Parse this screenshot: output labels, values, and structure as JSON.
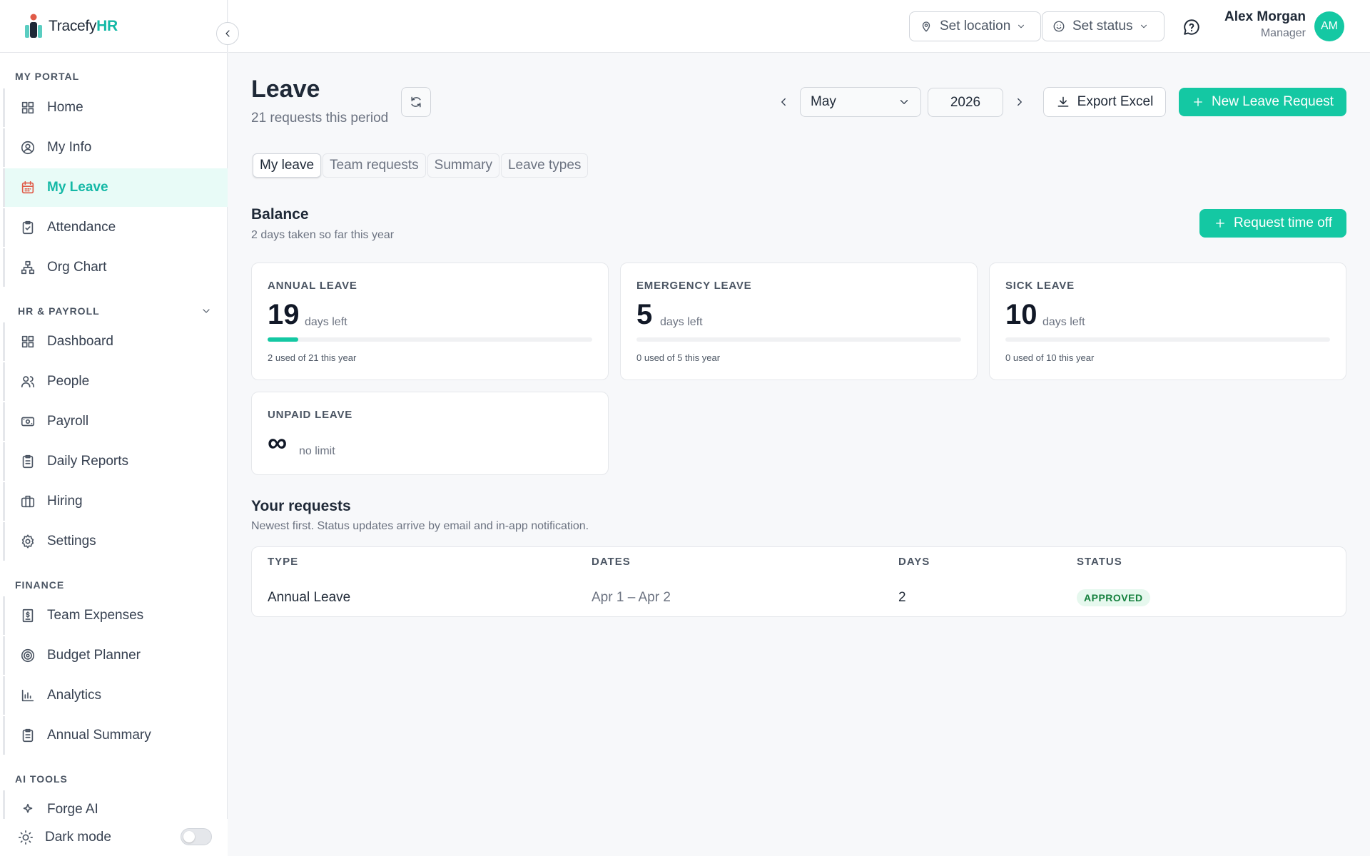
{
  "brand": {
    "prefix": "Tracefy",
    "suffix": "HR"
  },
  "sidebar": {
    "sections": {
      "my_portal": "MY PORTAL",
      "hr_payroll": "HR & PAYROLL",
      "finance": "FINANCE",
      "ai_tools": "AI TOOLS"
    },
    "items": {
      "home": "Home",
      "my_info": "My Info",
      "my_leave": "My Leave",
      "attendance": "Attendance",
      "org_chart": "Org Chart",
      "dashboard": "Dashboard",
      "people": "People",
      "payroll": "Payroll",
      "daily_reports": "Daily Reports",
      "hiring": "Hiring",
      "settings": "Settings",
      "team_expenses": "Team Expenses",
      "budget_planner": "Budget Planner",
      "analytics": "Analytics",
      "annual_summary": "Annual Summary",
      "forge_ai": "Forge AI"
    },
    "dark_mode": "Dark mode"
  },
  "topbar": {
    "location": "Set location",
    "status": "Set status",
    "user_name": "Alex Morgan",
    "user_role": "Manager",
    "avatar_initials": "AM"
  },
  "page": {
    "title": "Leave",
    "subtitle": "21 requests this period",
    "month": "May",
    "year": "2026",
    "export": "Export Excel",
    "new_request": "New Leave Request"
  },
  "tabs": [
    "My leave",
    "Team requests",
    "Summary",
    "Leave types"
  ],
  "balance": {
    "title": "Balance",
    "subtitle": "2 days taken so far this year",
    "request_btn": "Request time off",
    "cards": [
      {
        "label": "ANNUAL LEAVE",
        "value": "19",
        "unit": "days left",
        "used_fraction": 0.095,
        "note": "2 used of 21 this year"
      },
      {
        "label": "EMERGENCY LEAVE",
        "value": "5",
        "unit": "days left",
        "used_fraction": 0,
        "note": "0 used of 5 this year"
      },
      {
        "label": "SICK LEAVE",
        "value": "10",
        "unit": "days left",
        "used_fraction": 0,
        "note": "0 used of 10 this year"
      },
      {
        "label": "UNPAID LEAVE",
        "value": "∞",
        "unit": "no limit"
      }
    ]
  },
  "requests": {
    "title": "Your requests",
    "subtitle": "Newest first. Status updates arrive by email and in-app notification.",
    "columns": [
      "TYPE",
      "DATES",
      "DAYS",
      "STATUS"
    ],
    "rows": [
      {
        "type": "Annual Leave",
        "dates": "Apr 1 – Apr 2",
        "days": "2",
        "status": "APPROVED"
      }
    ]
  },
  "colors": {
    "accent": "#14c8a3",
    "active_icon": "#e05a47",
    "approved_bg": "#e6f8ee",
    "approved_text": "#15803d"
  }
}
